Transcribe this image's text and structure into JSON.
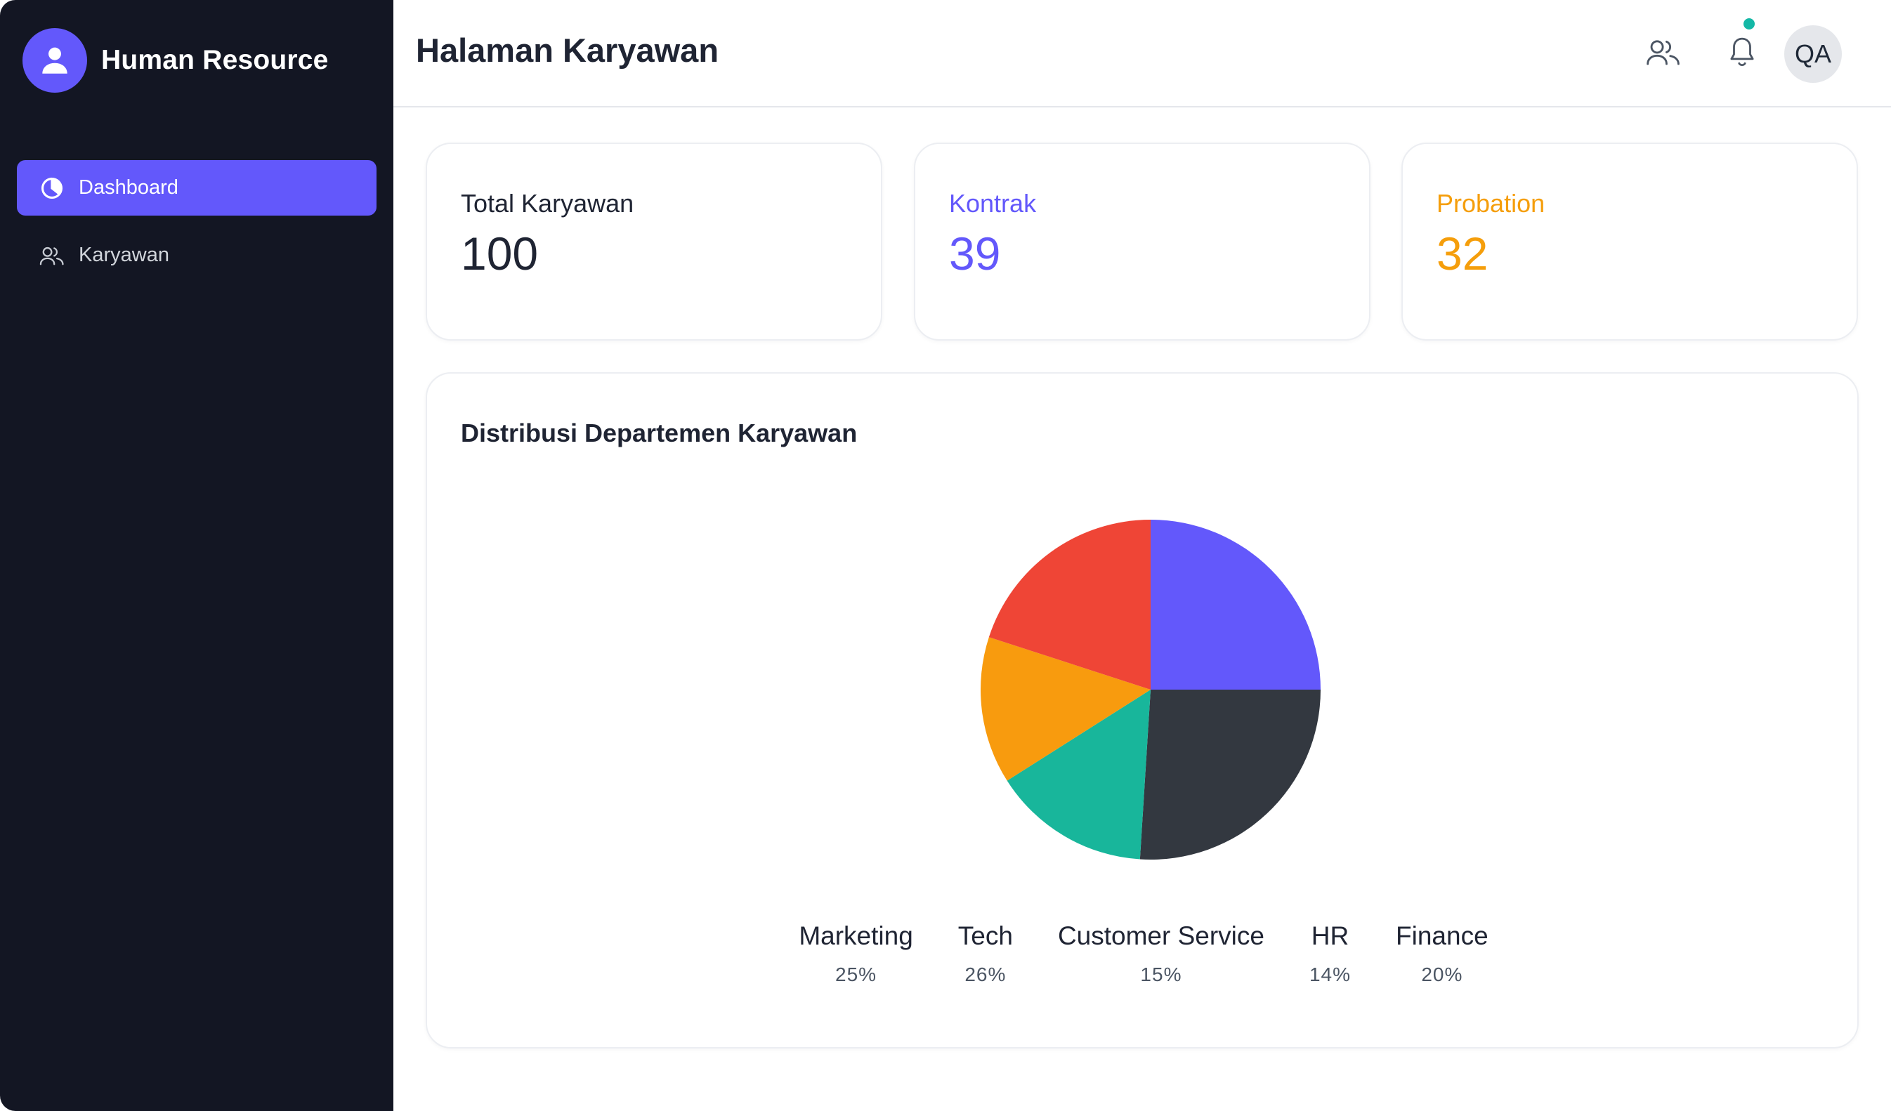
{
  "sidebar": {
    "brand_title": "Human Resource",
    "brand_icon": "user-icon",
    "items": [
      {
        "label": "Dashboard",
        "icon": "pie-chart-icon",
        "active": true
      },
      {
        "label": "Karyawan",
        "icon": "users-icon",
        "active": false
      }
    ]
  },
  "header": {
    "title": "Halaman Karyawan",
    "avatar_initials": "QA",
    "icons": [
      "users-icon",
      "bell-icon"
    ],
    "notification_dot_color": "#14b8a6"
  },
  "stats": [
    {
      "label": "Total Karyawan",
      "value": "100",
      "color": "#1f2433"
    },
    {
      "label": "Kontrak",
      "value": "39",
      "color": "#6358fb"
    },
    {
      "label": "Probation",
      "value": "32",
      "color": "#f59e0b"
    }
  ],
  "chart_section": {
    "title": "Distribusi Departemen Karyawan"
  },
  "chart_data": {
    "type": "pie",
    "categories": [
      "Marketing",
      "Tech",
      "Customer Service",
      "HR",
      "Finance"
    ],
    "values": [
      25,
      26,
      15,
      14,
      20
    ],
    "value_labels": [
      "25%",
      "26%",
      "15%",
      "14%",
      "20%"
    ],
    "colors": [
      "#6358fb",
      "#333840",
      "#18b69b",
      "#f89b0e",
      "#ef4536"
    ],
    "legend_position": "bottom"
  },
  "colors": {
    "accent": "#6358fb",
    "sidebar_bg": "#131623",
    "probation": "#f59e0b"
  }
}
